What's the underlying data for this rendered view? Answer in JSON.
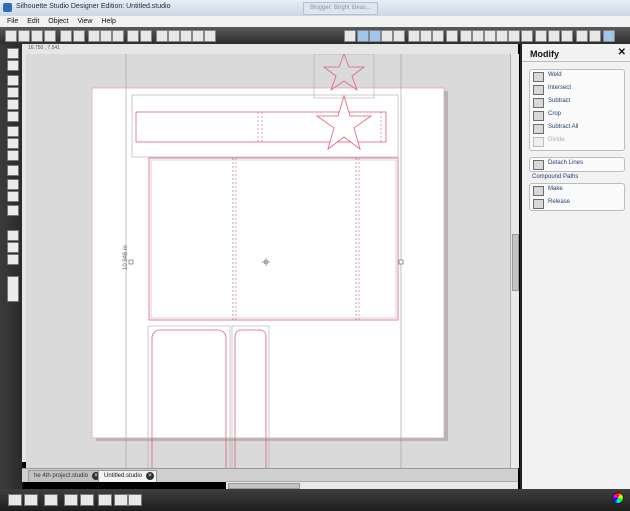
{
  "window": {
    "title": "Silhouette Studio Designer Edition: Untitled.studio",
    "background_tab": "Blogger: Bright Ideas..."
  },
  "menu": [
    "File",
    "Edit",
    "Object",
    "View",
    "Help"
  ],
  "ruler": {
    "readout": "16.750 , 7.541"
  },
  "canvas": {
    "height_readout": "10.946 in",
    "accent_color": "#e0607a"
  },
  "doc_tabs": [
    {
      "label": "he 4th project.studio",
      "active": false
    },
    {
      "label": "Untitled.studio",
      "active": true
    }
  ],
  "modify_panel": {
    "title": "Modify",
    "close": "✕",
    "buttons": [
      {
        "label": "Weld",
        "icon": "weld-icon",
        "enabled": true
      },
      {
        "label": "Intersect",
        "icon": "intersect-icon",
        "enabled": true
      },
      {
        "label": "Subtract",
        "icon": "subtract-icon",
        "enabled": true
      },
      {
        "label": "Crop",
        "icon": "crop-icon",
        "enabled": true
      },
      {
        "label": "Subtract All",
        "icon": "subtract-all-icon",
        "enabled": true
      },
      {
        "label": "Divide",
        "icon": "divide-icon",
        "enabled": false
      }
    ],
    "detach_label": "Detach Lines",
    "compound_label": "Compound Paths",
    "make_label": "Make",
    "release_label": "Release"
  }
}
